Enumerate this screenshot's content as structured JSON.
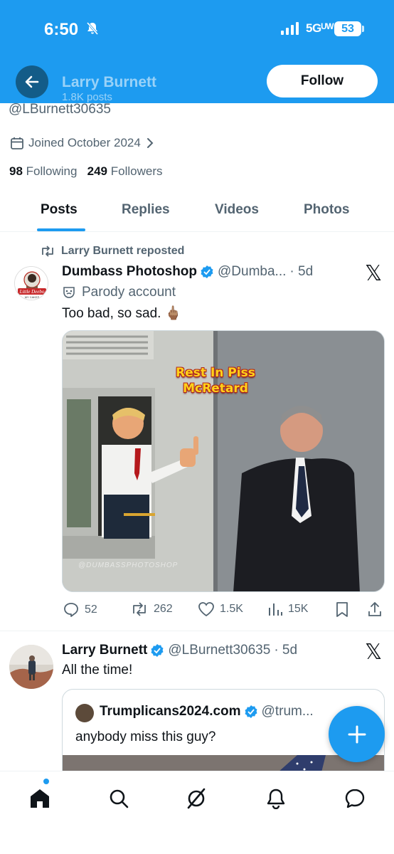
{
  "status_bar": {
    "time": "6:50",
    "network": "5Gᵁᵂ",
    "battery": "53"
  },
  "header": {
    "name": "Larry Burnett",
    "posts_count": "1.8K posts",
    "follow_label": "Follow"
  },
  "profile": {
    "handle": "@LBurnett30635",
    "joined": "Joined October 2024",
    "following_count": "98",
    "following_label": "Following",
    "followers_count": "249",
    "followers_label": "Followers"
  },
  "tabs": [
    {
      "label": "Posts",
      "active": true
    },
    {
      "label": "Replies",
      "active": false
    },
    {
      "label": "Videos",
      "active": false
    },
    {
      "label": "Photos",
      "active": false
    }
  ],
  "posts": [
    {
      "repost_label": "Larry Burnett reposted",
      "author_name": "Dumbass Photoshop",
      "author_handle": "@Dumba...",
      "age": "· 5d",
      "parody_label": "Parody account",
      "text": "Too bad, so sad. 🖕🏽",
      "media_caption": "Rest In Piss McRetard",
      "media_watermark": "@DUMBASSPHOTOSHOP",
      "avatar_text": "Little Deebo",
      "stats": {
        "replies": "52",
        "reposts": "262",
        "likes": "1.5K",
        "views": "15K"
      }
    },
    {
      "author_name": "Larry Burnett",
      "author_handle": "@LBurnett30635",
      "age": "· 5d",
      "text": "All the time!",
      "quote": {
        "author_name": "Trumplicans2024.com",
        "author_handle": "@trum...",
        "text": "anybody miss this guy?"
      }
    }
  ],
  "colors": {
    "brand": "#1d9bf0",
    "text": "#0f1419",
    "muted": "#536471"
  },
  "bottom_nav": [
    "home-icon",
    "search-icon",
    "grok-icon",
    "notifications-icon",
    "messages-icon"
  ]
}
